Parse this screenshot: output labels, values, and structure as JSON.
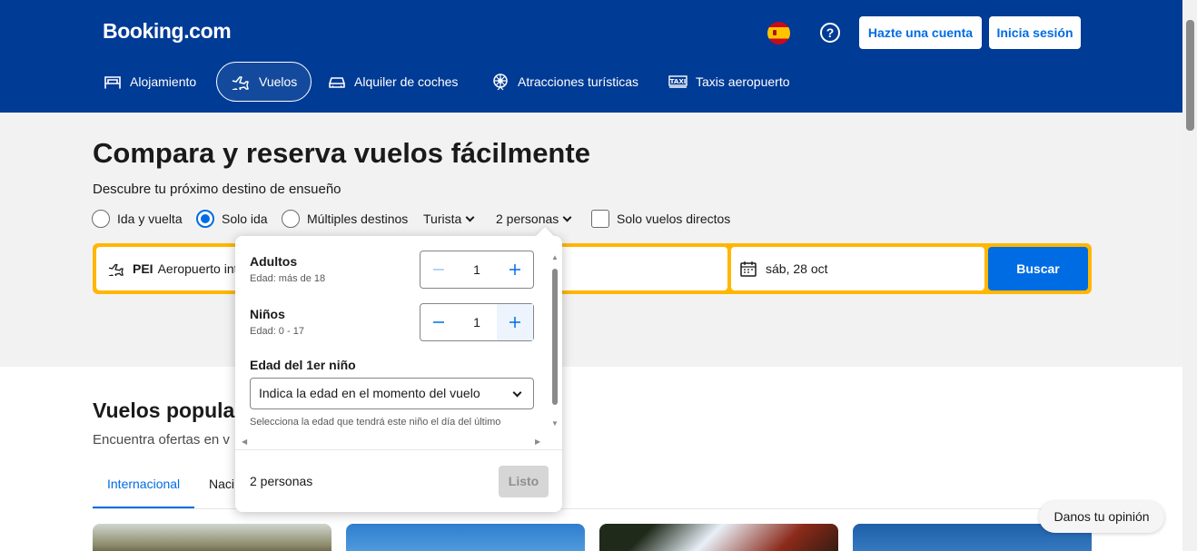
{
  "header": {
    "logo": "Booking.com",
    "help_glyph": "?",
    "register_label": "Hazte una cuenta",
    "login_label": "Inicia sesión",
    "nav": [
      {
        "label": "Alojamiento",
        "icon": "bed-icon"
      },
      {
        "label": "Vuelos",
        "icon": "plane-icon",
        "active": true
      },
      {
        "label": "Alquiler de coches",
        "icon": "car-icon"
      },
      {
        "label": "Atracciones turísticas",
        "icon": "attractions-icon"
      },
      {
        "label": "Taxis aeropuerto",
        "icon": "taxi-icon"
      }
    ]
  },
  "hero": {
    "title": "Compara y reserva vuelos fácilmente",
    "subtitle": "Descubre tu próximo destino de ensueño",
    "trip_types": [
      "Ida y vuelta",
      "Solo ida",
      "Múltiples destinos"
    ],
    "selected_trip_type": "Solo ida",
    "cabin_class": "Turista",
    "passengers": "2 personas",
    "direct_only_label": "Solo vuelos directos"
  },
  "search": {
    "origin_code": "PEI",
    "origin_name": "Aeropuerto inte",
    "date": "sáb, 28 oct",
    "button": "Buscar"
  },
  "passenger_dropdown": {
    "adults_label": "Adultos",
    "adults_hint": "Edad: más de 18",
    "adults_value": "1",
    "children_label": "Niños",
    "children_hint": "Edad: 0 - 17",
    "children_value": "1",
    "child_age_label": "Edad del 1er niño",
    "child_age_placeholder": "Indica la edad en el momento del vuelo",
    "child_age_note": "Selecciona la edad que tendrá este niño el día del último",
    "footer_summary": "2 personas",
    "done_label": "Listo"
  },
  "popular": {
    "title": "Vuelos popula",
    "subtitle": "Encuentra ofertas en v",
    "tabs": [
      "Internacional",
      "Naci"
    ]
  },
  "feedback_label": "Danos tu opinión",
  "colors": {
    "brand_blue": "#003b95",
    "action_blue": "#006ce4",
    "searchbar_yellow": "#ffb700"
  }
}
